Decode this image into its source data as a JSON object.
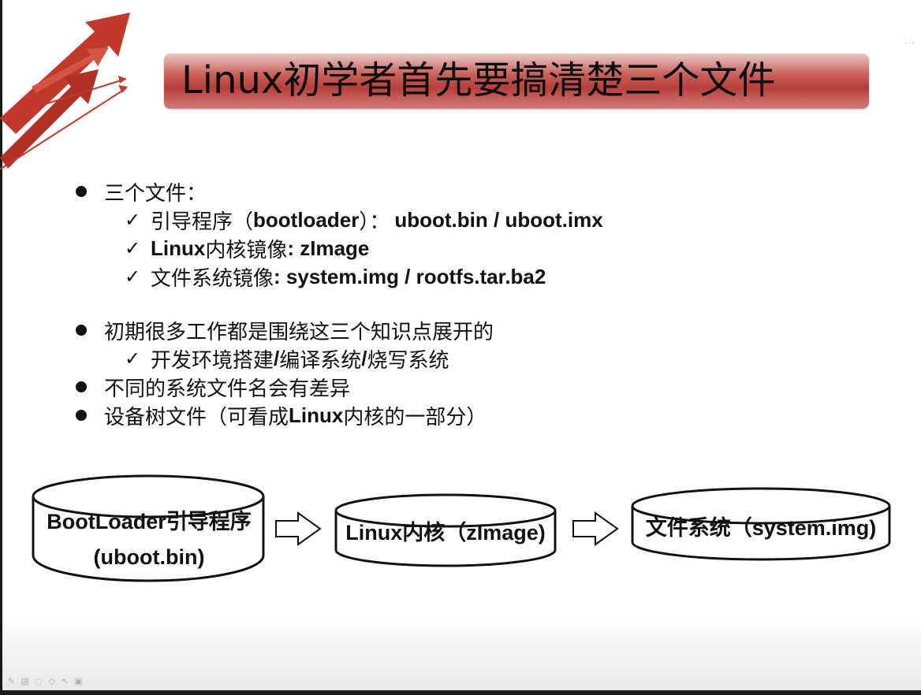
{
  "slide": {
    "title": "Linux初学者首先要搞清楚三个文件",
    "corner_text": "...",
    "colors": {
      "title_bar": "#b83f3a",
      "logo_red": "#c0392b",
      "text": "#111111"
    }
  },
  "content": {
    "b1": {
      "label": "三个文件：",
      "subs": [
        {
          "prefix": "引导程序（",
          "bold": "bootloader",
          "middle": "）：",
          "bold2": "uboot.bin / uboot.imx"
        },
        {
          "bold": "Linux",
          "middle": "内核镜像",
          "bold2": ": zImage"
        },
        {
          "prefix": "文件系统镜像",
          "bold2": ": system.img / rootfs.tar.ba2"
        }
      ]
    },
    "b2": {
      "label": "初期很多工作都是围绕这三个知识点展开的",
      "subs": [
        {
          "prefix": "开发环境搭建",
          "b1": "/",
          "mid": "编译系统",
          "b2": "/",
          "suffix": "烧写系统"
        }
      ]
    },
    "b3": {
      "label": "不同的系统文件名会有差异"
    },
    "b4": {
      "prefix": "设备树文件（可看成",
      "bold": "Linux",
      "suffix": "内核的一部分）"
    }
  },
  "flow": {
    "node1": {
      "line1": "BootLoader引导程序",
      "line2": "(uboot.bin)"
    },
    "node2": {
      "label": "Linux内核（zImage)"
    },
    "node3": {
      "label": "文件系统（system.img)"
    }
  },
  "toolbar": {
    "icons": [
      "pen-icon",
      "note-icon",
      "eraser-icon",
      "highlighter-icon",
      "pointer-icon",
      "screen-icon"
    ]
  }
}
